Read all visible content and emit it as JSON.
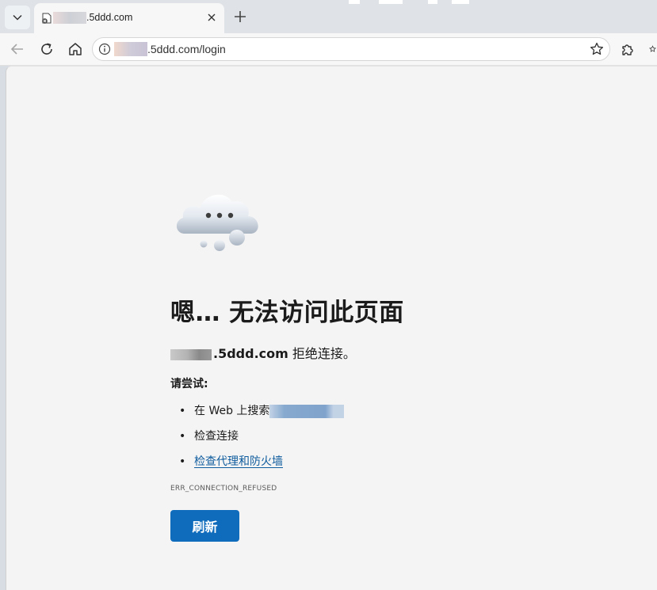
{
  "browser": {
    "tab": {
      "title": ".5ddd.com"
    },
    "address_bar": {
      "url": ".5ddd.com/login"
    }
  },
  "error_page": {
    "title": "嗯… 无法访问此页面",
    "host": ".5ddd.com",
    "refused_text": "拒绝连接。",
    "try_heading": "请尝试:",
    "suggestions": [
      {
        "prefix": "在 Web 上搜索"
      },
      {
        "label": "检查连接"
      },
      {
        "label": "检查代理和防火墙"
      }
    ],
    "error_code": "ERR_CONNECTION_REFUSED",
    "refresh_label": "刷新"
  },
  "colors": {
    "accent": "#0f6cbd",
    "link": "#0f5c9e",
    "page_bg": "#f4f4f4"
  },
  "icons": [
    "chevron-down-icon",
    "site-error-favicon",
    "close-icon",
    "plus-icon",
    "back-icon",
    "reload-icon",
    "home-icon",
    "info-icon",
    "star-icon",
    "extensions-icon",
    "cloud-error-icon"
  ]
}
